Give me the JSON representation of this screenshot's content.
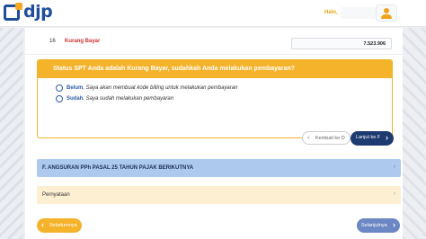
{
  "header": {
    "logo_text": "djp",
    "greeting": "Halo,"
  },
  "row": {
    "number": "16",
    "label": "Kurang Bayar",
    "amount": "7.523.906"
  },
  "question": {
    "title": "Status SPT Anda adalah Kurang Bayar, sudahkah Anda melakukan pembayaran?",
    "options": [
      {
        "strong": "Belum",
        "text": ", Saya akan membuat kode billing untuk melakukan pembayaran"
      },
      {
        "strong": "Sudah",
        "text": ", Saya sudah melakukan pembayaran"
      }
    ]
  },
  "nav": {
    "back_label": "Kembali ke D",
    "next_label": "Lanjut ke F"
  },
  "sections": {
    "f_title": "F. ANGSURAN PPh PASAL 25 TAHUN PAJAK BERIKUTNYA",
    "statement_title": "Pernyataan"
  },
  "footer": {
    "prev_label": "Sebelumnya",
    "next_label": "Selanjutnya"
  },
  "colors": {
    "brand_blue": "#1e4e9c",
    "accent_yellow": "#f5b22b",
    "alert_red": "#d0312d",
    "nav_dark": "#1d3b70"
  }
}
